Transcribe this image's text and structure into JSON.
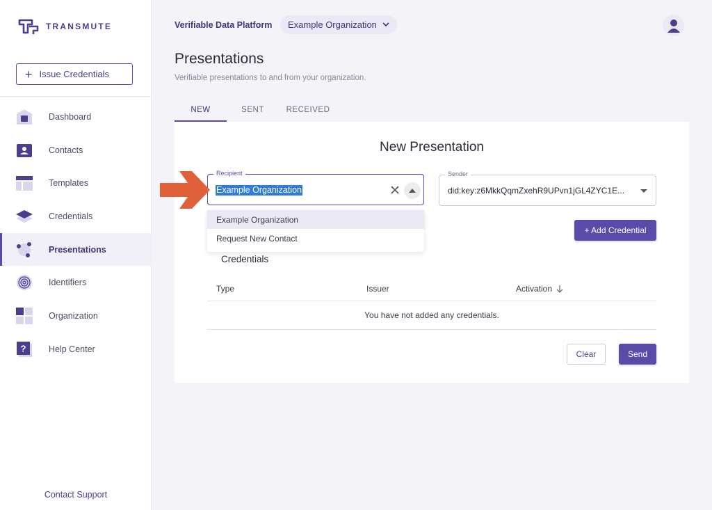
{
  "brand": {
    "name": "TRANSMUTE"
  },
  "sidebar": {
    "issue_button": "Issue Credentials",
    "items": [
      {
        "label": "Dashboard",
        "icon": "house-icon"
      },
      {
        "label": "Contacts",
        "icon": "contact-card-icon"
      },
      {
        "label": "Templates",
        "icon": "template-icon"
      },
      {
        "label": "Credentials",
        "icon": "layers-icon"
      },
      {
        "label": "Presentations",
        "icon": "network-nodes-icon",
        "active": true
      },
      {
        "label": "Identifiers",
        "icon": "fingerprint-icon"
      },
      {
        "label": "Organization",
        "icon": "grid-icon"
      },
      {
        "label": "Help Center",
        "icon": "help-icon"
      }
    ],
    "contact_support": "Contact Support"
  },
  "header": {
    "platform_title": "Verifiable Data Platform",
    "org_select": "Example Organization"
  },
  "page": {
    "title": "Presentations",
    "subtitle": "Verifiable presentations to and from your organization.",
    "tabs": [
      {
        "label": "NEW",
        "active": true
      },
      {
        "label": "SENT"
      },
      {
        "label": "RECEIVED"
      }
    ]
  },
  "form": {
    "title": "New Presentation",
    "recipient": {
      "label": "Recipient",
      "value": "Example Organization"
    },
    "sender": {
      "label": "Sender",
      "value": "did:key:z6MkkQqmZxehR9UPvn1jGL4ZYC1E..."
    },
    "dropdown_options": [
      "Example Organization",
      "Request New Contact"
    ],
    "add_credential": "+ Add Credential",
    "credentials_title": "Credentials",
    "table": {
      "columns": [
        "Type",
        "Issuer",
        "Activation"
      ],
      "empty_message": "You have not added any credentials."
    },
    "clear_button": "Clear",
    "send_button": "Send"
  },
  "colors": {
    "primary": "#5b4aa8",
    "primary_dark": "#3d3480",
    "arrow": "#e0603a",
    "selection": "#2f7bde"
  }
}
